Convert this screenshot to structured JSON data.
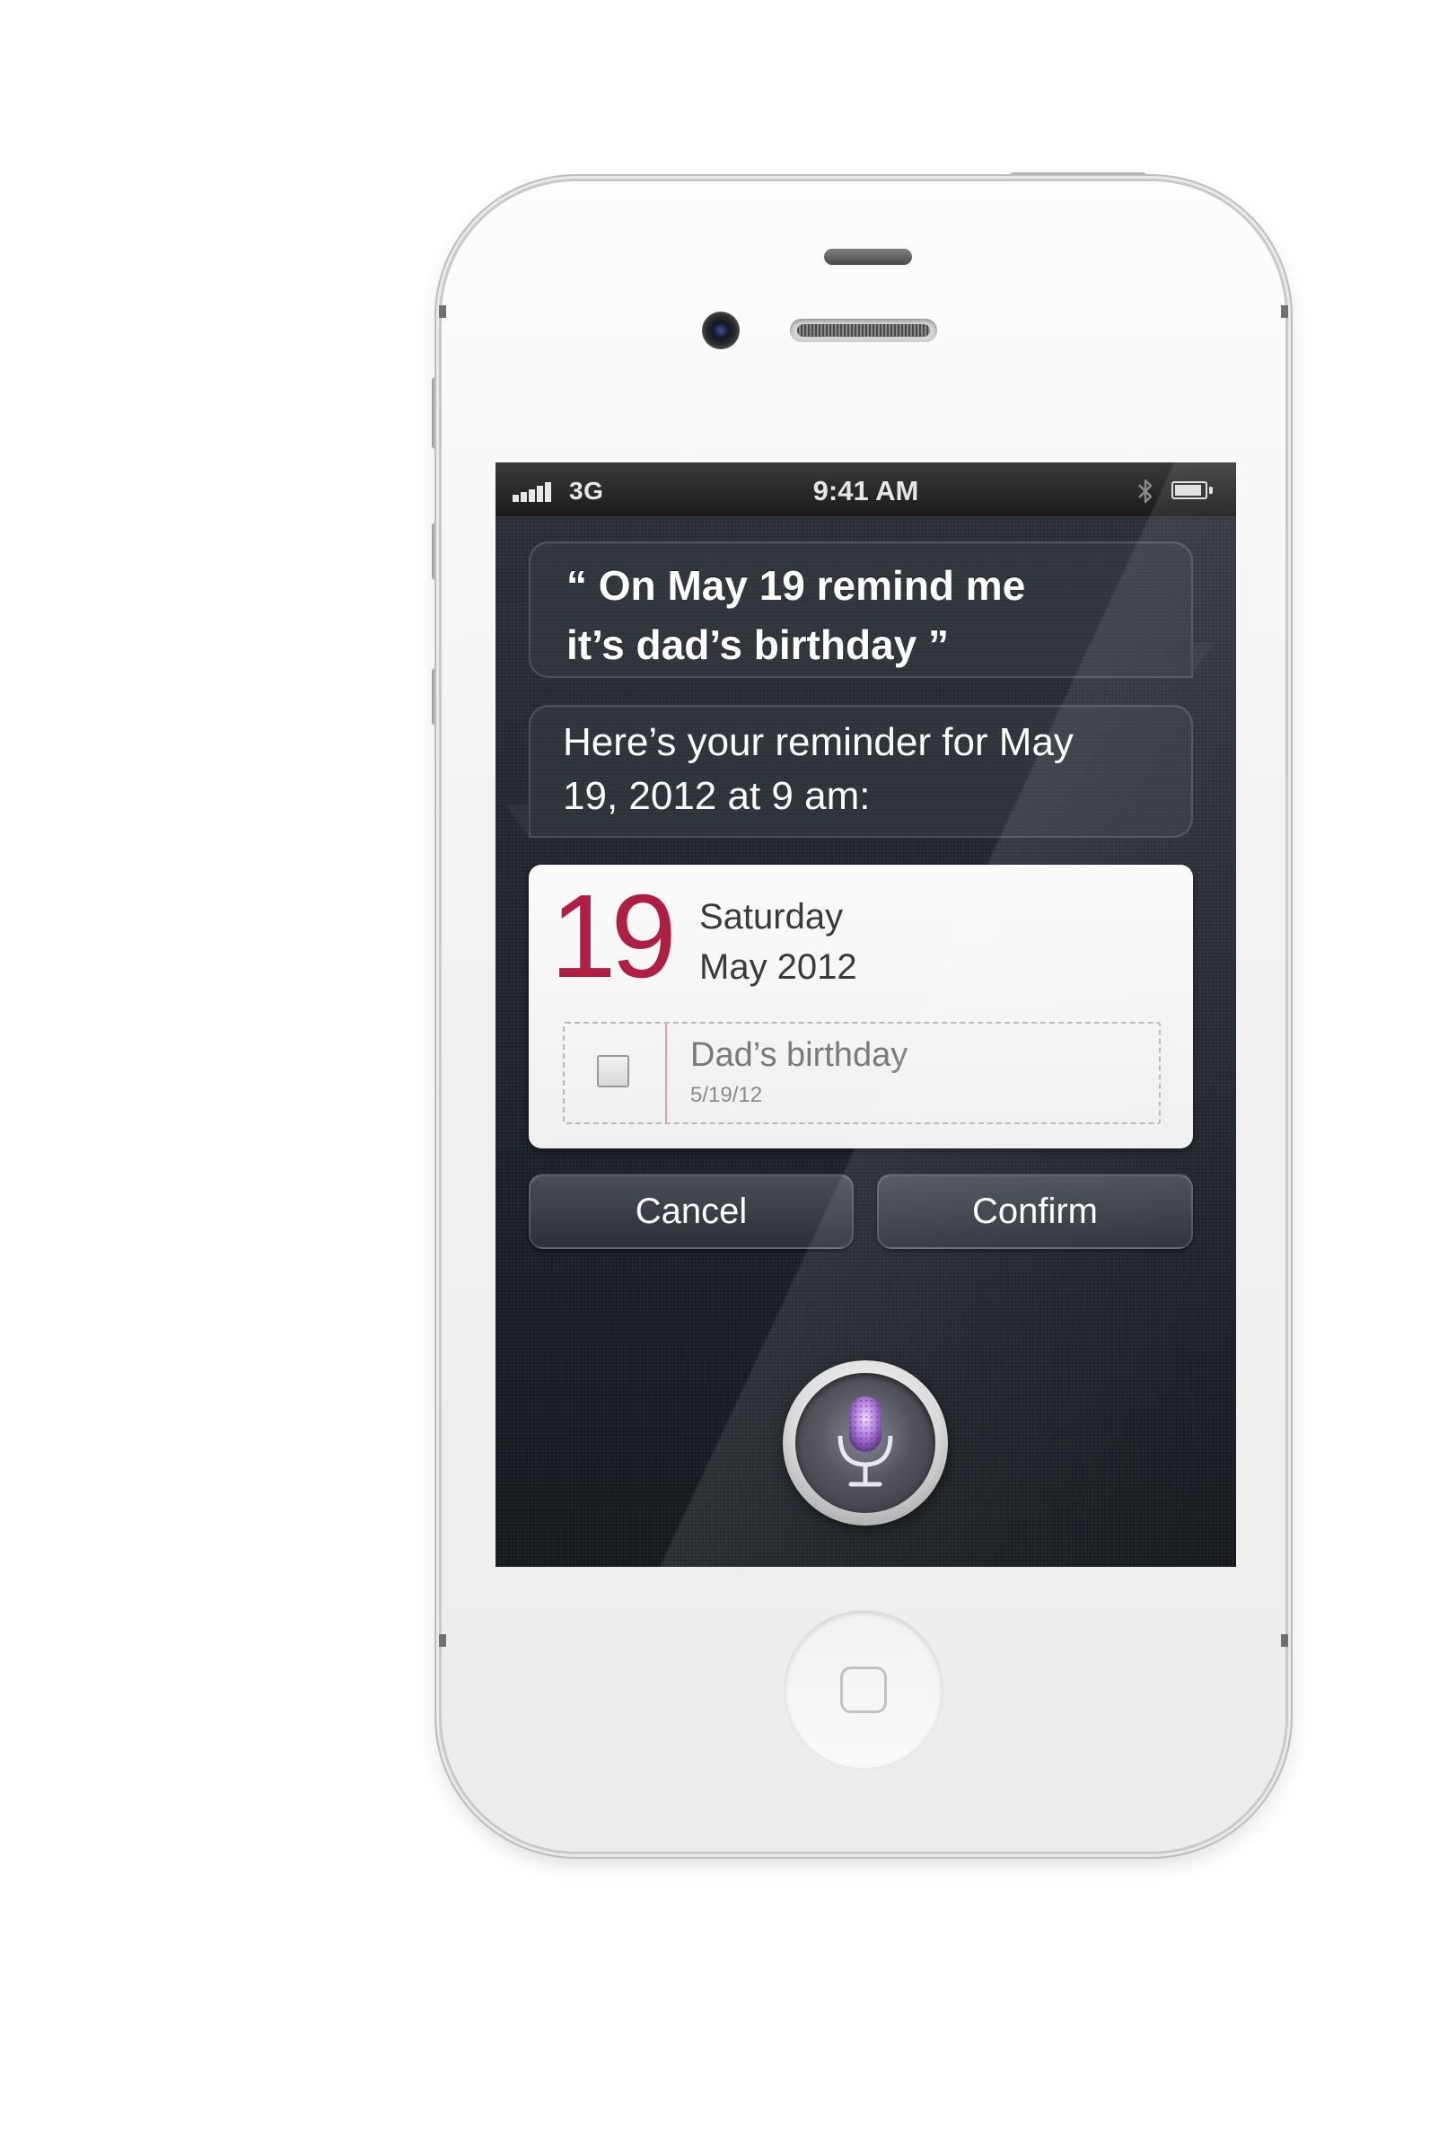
{
  "status_bar": {
    "carrier": "3G",
    "time": "9:41 AM",
    "signal_bars": 5,
    "bluetooth_icon": "bluetooth-icon",
    "battery_icon": "battery-icon",
    "battery_level": 0.9
  },
  "siri": {
    "user_utterance": "“ On May 19 remind me\n   it’s dad’s birthday ”",
    "response": "Here’s your reminder for May\n19, 2012 at 9 am:"
  },
  "reminder_card": {
    "day_number": "19",
    "weekday": "Saturday",
    "month_year": "May 2012",
    "reminder_title": "Dad’s birthday",
    "reminder_date": "5/19/12",
    "accent_color": "#b01e43"
  },
  "actions": {
    "cancel_label": "Cancel",
    "confirm_label": "Confirm"
  },
  "icons": {
    "mic": "microphone-icon",
    "home": "home-square-icon",
    "camera": "front-camera-icon"
  }
}
